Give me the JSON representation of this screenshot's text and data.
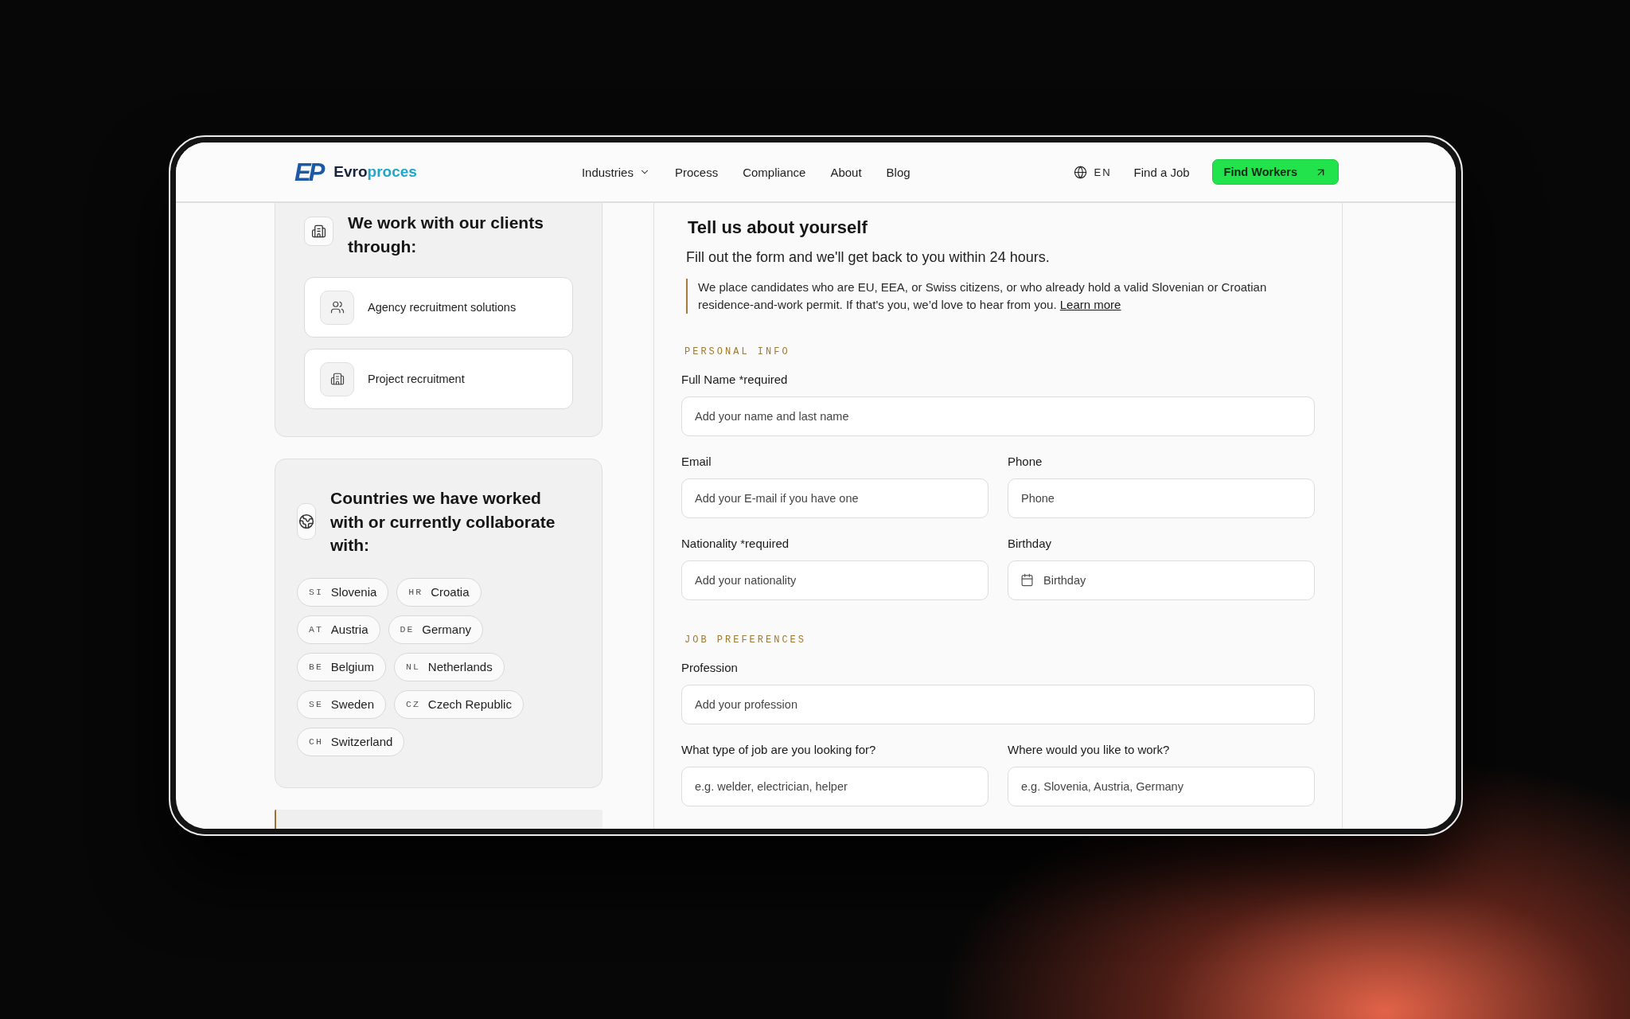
{
  "header": {
    "logo": {
      "mark": "EP",
      "name_parts": [
        "Evro",
        "proces"
      ]
    },
    "nav": [
      {
        "label": "Industries",
        "kind": "dropdown"
      },
      {
        "label": "Process",
        "kind": "link"
      },
      {
        "label": "Compliance",
        "kind": "link"
      },
      {
        "label": "About",
        "kind": "link"
      },
      {
        "label": "Blog",
        "kind": "link"
      }
    ],
    "language": "EN",
    "secondary_link": "Find a Job",
    "cta": "Find Workers"
  },
  "sidebar": {
    "services": {
      "title": "We work with our clients through:",
      "options": [
        {
          "label": "Agency recruitment solutions",
          "kind": "agency"
        },
        {
          "label": "Project recruitment",
          "kind": "project"
        }
      ]
    },
    "countries": {
      "title": "Countries we have worked with or currently collaborate with:",
      "items": [
        {
          "code": "SI",
          "name": "Slovenia"
        },
        {
          "code": "HR",
          "name": "Croatia"
        },
        {
          "code": "AT",
          "name": "Austria"
        },
        {
          "code": "DE",
          "name": "Germany"
        },
        {
          "code": "BE",
          "name": "Belgium"
        },
        {
          "code": "NL",
          "name": "Netherlands"
        },
        {
          "code": "SE",
          "name": "Sweden"
        },
        {
          "code": "CZ",
          "name": "Czech Republic"
        },
        {
          "code": "CH",
          "name": "Switzerland"
        }
      ]
    }
  },
  "form": {
    "title": "Tell us about yourself",
    "subtitle": "Fill out the form and we'll get back to you within 24 hours.",
    "notice": {
      "text": "We place candidates who are EU, EEA, or Swiss citizens, or who already hold a valid Slovenian or Croatian residence-and-work permit. If that's you, we’d love to hear from you.",
      "link": "Learn more"
    },
    "sections": [
      {
        "heading": "PERSONAL INFO",
        "rows": [
          {
            "fields": [
              {
                "label": "Full Name *required",
                "placeholder": "Add your name and last name",
                "kind": "text"
              }
            ]
          },
          {
            "fields": [
              {
                "label": "Email",
                "placeholder": "Add your E-mail if you have one",
                "kind": "text"
              },
              {
                "label": "Phone",
                "placeholder": "Phone",
                "kind": "text"
              }
            ]
          },
          {
            "fields": [
              {
                "label": "Nationality *required",
                "placeholder": "Add your nationality",
                "kind": "text"
              },
              {
                "label": "Birthday",
                "placeholder": "Birthday",
                "kind": "date"
              }
            ]
          }
        ]
      },
      {
        "heading": "JOB PREFERENCES",
        "rows": [
          {
            "fields": [
              {
                "label": "Profession",
                "placeholder": "Add your profession",
                "kind": "text"
              }
            ]
          },
          {
            "fields": [
              {
                "label": "What type of job are you looking for?",
                "placeholder": "e.g. welder, electrician, helper",
                "kind": "text"
              },
              {
                "label": "Where would you like to work?",
                "placeholder": "e.g. Slovenia, Austria, Germany",
                "kind": "text"
              }
            ]
          }
        ]
      }
    ]
  }
}
